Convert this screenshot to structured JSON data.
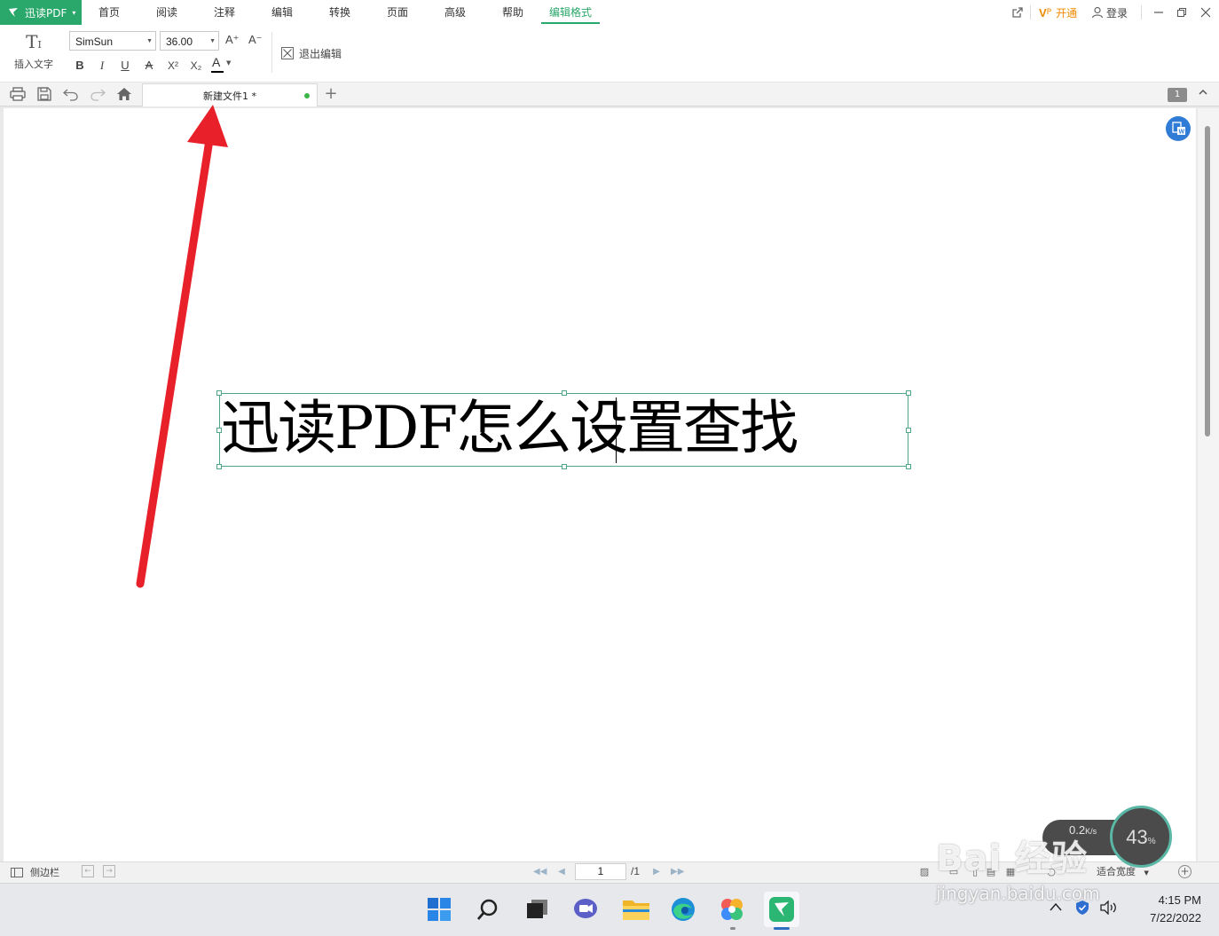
{
  "app": {
    "name": "迅读PDF",
    "accent_color": "#2aa76a"
  },
  "menu": {
    "items": [
      "首页",
      "阅读",
      "注释",
      "编辑",
      "转换",
      "页面",
      "高级",
      "帮助",
      "编辑格式"
    ],
    "active": "编辑格式"
  },
  "header_right": {
    "vip_label": "开通",
    "login_label": "登录"
  },
  "format_toolbar": {
    "insert_text_label": "插入文字",
    "font_family": "SimSun",
    "font_size": "36.00",
    "exit_edit_label": "退出编辑",
    "grow_font_icon": "A⁺",
    "shrink_font_icon": "A⁻",
    "bold": "B",
    "italic": "I",
    "underline": "U",
    "strikethrough": "A",
    "superscript": "X²",
    "subscript": "X₂",
    "font_color": "A"
  },
  "tabs": {
    "doc_title": "新建文件1 *",
    "page_badge": "1"
  },
  "document": {
    "text": "迅读PDF怎么设置查找"
  },
  "statusbar": {
    "sidebar_label": "侧边栏",
    "current_page": "1",
    "total_pages": "/1",
    "zoom_label": "适合宽度"
  },
  "net_monitor": {
    "speed": "0.2",
    "speed_unit": "K/s",
    "percent": "43",
    "percent_unit": "%"
  },
  "taskbar": {
    "time": "4:15 PM",
    "date": "7/22/2022"
  },
  "watermark": {
    "logo": "Bai  经验",
    "url": "jingyan.baidu.com"
  }
}
